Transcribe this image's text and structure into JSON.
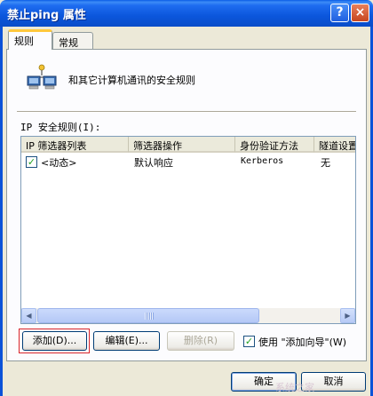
{
  "window": {
    "title": "禁止ping 属性",
    "help_glyph": "?",
    "close_glyph": "×"
  },
  "tabs": [
    {
      "label": "规则",
      "active": true
    },
    {
      "label": "常规",
      "active": false
    }
  ],
  "description": "和其它计算机通讯的安全规则",
  "rules_list": {
    "label": "IP 安全规则(I):",
    "columns": [
      "IP 筛选器列表",
      "筛选器操作",
      "身份验证方法",
      "隧道设置"
    ],
    "rows": [
      {
        "checked": true,
        "check_glyph": "✓",
        "filter_list": "<动态>",
        "filter_action": "默认响应",
        "auth": "Kerberos",
        "tunnel": "无"
      }
    ]
  },
  "scrollbar": {
    "left_arrow": "◀",
    "right_arrow": "▶"
  },
  "buttons": {
    "add": "添加(D)...",
    "edit": "编辑(E)...",
    "remove": "删除(R)",
    "ok": "确定",
    "cancel": "取消"
  },
  "wizard": {
    "checked": true,
    "check_glyph": "✓",
    "label": "使用 \"添加向导\"(W)"
  },
  "watermark": "系统之家",
  "colors": {
    "titlebar": "#0b56dc",
    "face": "#ece9d8",
    "highlight_outline": "#d9252b"
  },
  "icons": {
    "rules": "network-computers-icon"
  }
}
